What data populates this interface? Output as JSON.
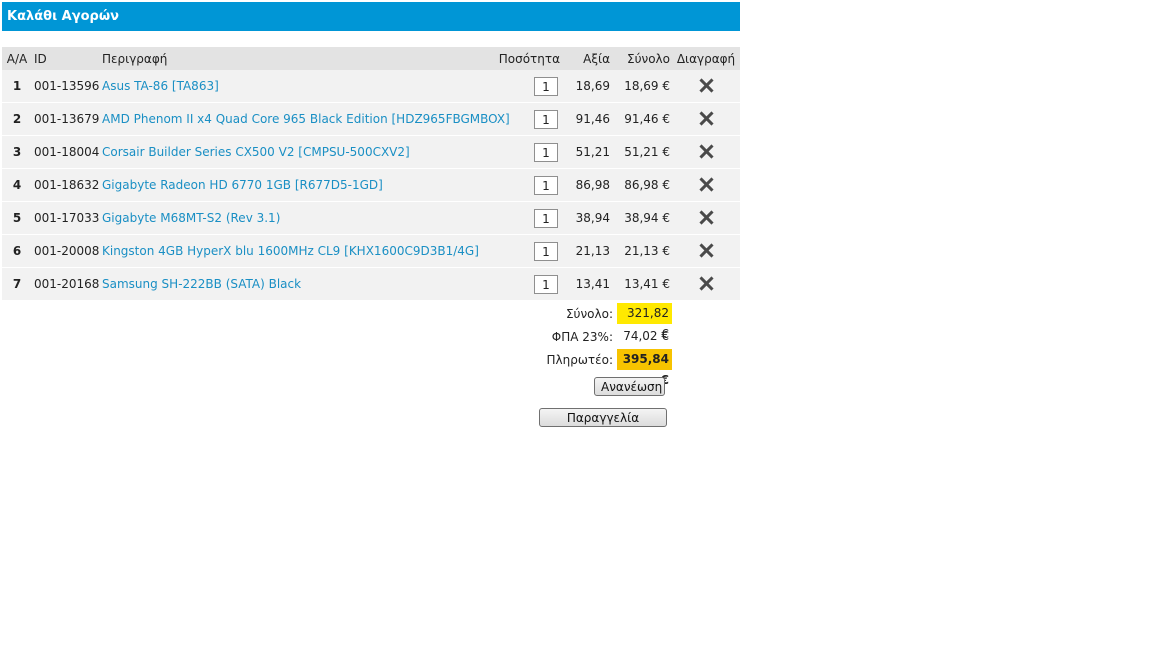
{
  "header": {
    "title": "Καλάθι Αγορών"
  },
  "columns": {
    "aa": "Α/Α",
    "id": "ID",
    "description": "Περιγραφή",
    "quantity": "Ποσότητα",
    "value": "Αξία",
    "total": "Σύνολο",
    "delete": "Διαγραφή"
  },
  "items": [
    {
      "aa": "1",
      "id": "001-13596",
      "description": "Asus TA-86 [TA863]",
      "quantity": "1",
      "value": "18,69",
      "total": "18,69 €"
    },
    {
      "aa": "2",
      "id": "001-13679",
      "description": "AMD Phenom II x4 Quad Core 965 Black Edition [HDZ965FBGMBOX]",
      "quantity": "1",
      "value": "91,46",
      "total": "91,46 €"
    },
    {
      "aa": "3",
      "id": "001-18004",
      "description": "Corsair Builder Series CX500 V2 [CMPSU-500CXV2]",
      "quantity": "1",
      "value": "51,21",
      "total": "51,21 €"
    },
    {
      "aa": "4",
      "id": "001-18632",
      "description": "Gigabyte Radeon HD 6770 1GB [R677D5-1GD]",
      "quantity": "1",
      "value": "86,98",
      "total": "86,98 €"
    },
    {
      "aa": "5",
      "id": "001-17033",
      "description": "Gigabyte M68MT-S2 (Rev 3.1)",
      "quantity": "1",
      "value": "38,94",
      "total": "38,94 €"
    },
    {
      "aa": "6",
      "id": "001-20008",
      "description": "Kingston 4GB HyperX blu 1600MHz CL9 [KHX1600C9D3B1/4G]",
      "quantity": "1",
      "value": "21,13",
      "total": "21,13 €"
    },
    {
      "aa": "7",
      "id": "001-20168",
      "description": "Samsung SH-222BB (SATA) Black",
      "quantity": "1",
      "value": "13,41",
      "total": "13,41 €"
    }
  ],
  "totals": {
    "subtotal_label": "Σύνολο:",
    "subtotal": "321,82 €",
    "vat_label": "ΦΠΑ 23%:",
    "vat": "74,02 €",
    "payable_label": "Πληρωτέο:",
    "payable": "395,84 €"
  },
  "buttons": {
    "refresh": "Ανανέωση",
    "order": "Παραγγελία"
  },
  "icons": {
    "delete": "close-icon"
  },
  "colors": {
    "header_bg": "#0096d6",
    "link": "#1a8fc4",
    "subtotal_highlight": "#ffe900",
    "payable_highlight": "#f7c300"
  }
}
